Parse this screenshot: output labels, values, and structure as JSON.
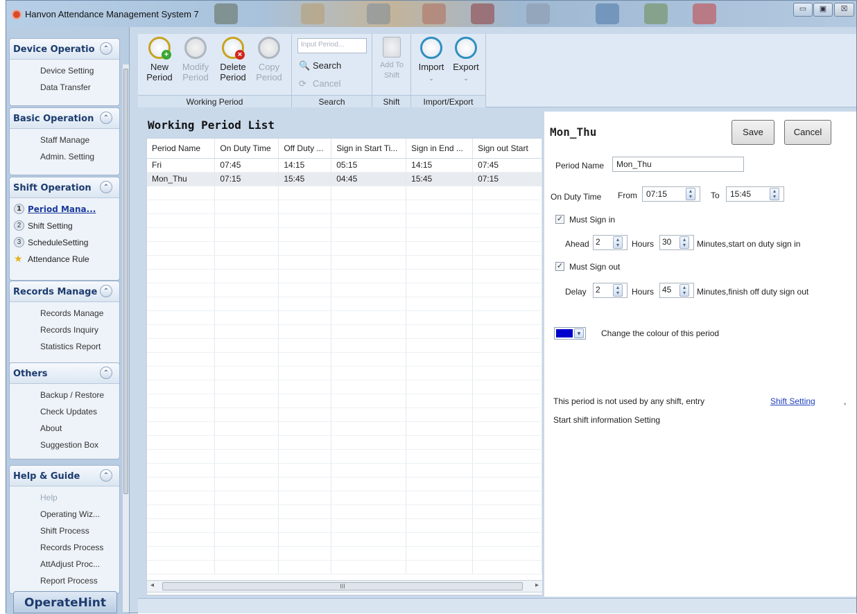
{
  "window": {
    "title": "Hanvon Attendance Management System 7",
    "min_glyph": "▭",
    "max_glyph": "▣",
    "close_glyph": "☒"
  },
  "sidebar": {
    "groups": [
      {
        "title": "Device Operatio",
        "items": [
          "Device Setting",
          "Data Transfer"
        ]
      },
      {
        "title": "Basic Operation",
        "items": [
          "Staff Manage",
          "Admin. Setting"
        ]
      },
      {
        "title": "Shift Operation",
        "items": [
          {
            "num": "1",
            "label": "Period Mana..."
          },
          {
            "num": "2",
            "label": "Shift Setting"
          },
          {
            "num": "3",
            "label": "ScheduleSetting"
          },
          {
            "label": "Attendance Rule"
          }
        ]
      },
      {
        "title": "Records Manage",
        "items": [
          "Records Manage",
          "Records Inquiry",
          "Statistics Report"
        ]
      },
      {
        "title": "Others",
        "items": [
          "Backup / Restore",
          "Check Updates",
          "About",
          "Suggestion Box"
        ]
      },
      {
        "title": "Help & Guide",
        "items": [
          "Help",
          "Operating Wiz...",
          "Shift Process",
          "Records Process",
          "AttAdjust Proc...",
          "Report Process"
        ]
      }
    ],
    "chevron": "⌃",
    "hint": "OperateHint"
  },
  "ribbon": {
    "working_period": {
      "label": "Working Period",
      "new_l1": "New",
      "new_l2": "Period",
      "modify_l1": "Modify",
      "modify_l2": "Period",
      "delete_l1": "Delete",
      "delete_l2": "Period",
      "copy_l1": "Copy",
      "copy_l2": "Period"
    },
    "search": {
      "label": "Search",
      "placeholder": "Input Period...",
      "search_btn": "Search",
      "cancel_btn": "Cancel"
    },
    "shift": {
      "label": "Shift",
      "add_l1": "Add To",
      "add_l2": "Shift"
    },
    "import_export": {
      "label": "Import/Export",
      "import": "Import",
      "export": "Export"
    }
  },
  "list": {
    "title": "Working Period List",
    "columns": [
      "Period Name",
      "On Duty Time",
      "Off Duty ...",
      "Sign in Start Ti...",
      "Sign in End ...",
      "Sign out Start"
    ],
    "rows": [
      [
        "Fri",
        "07:45",
        "14:15",
        "05:15",
        "14:15",
        "07:45"
      ],
      [
        "Mon_Thu",
        "07:15",
        "15:45",
        "04:45",
        "15:45",
        "07:15"
      ]
    ],
    "hscroll_grip": "III"
  },
  "detail": {
    "title": "Mon_Thu",
    "save": "Save",
    "cancel": "Cancel",
    "period_name_label": "Period Name",
    "period_name_value": "Mon_Thu",
    "on_duty_label": "On Duty Time",
    "from_label": "From",
    "from_value": "07:15",
    "to_label": "To",
    "to_value": "15:45",
    "must_sign_in": "Must Sign in",
    "must_sign_in_checked": true,
    "ahead_label": "Ahead",
    "ahead_hours": "2",
    "hours_label": "Hours",
    "ahead_minutes": "30",
    "ahead_suffix": "Minutes,start on duty sign in",
    "must_sign_out": "Must Sign out",
    "must_sign_out_checked": true,
    "delay_label": "Delay",
    "delay_hours": "2",
    "delay_minutes": "45",
    "delay_suffix": "Minutes,finish off duty sign out",
    "colour_label": "Change the colour of this period",
    "period_colour": "#0000cc",
    "info_line1": "This period is not used by any shift, entry",
    "info_link": "Shift Setting",
    "info_comma": ",",
    "info_line2": "Start shift information Setting"
  }
}
